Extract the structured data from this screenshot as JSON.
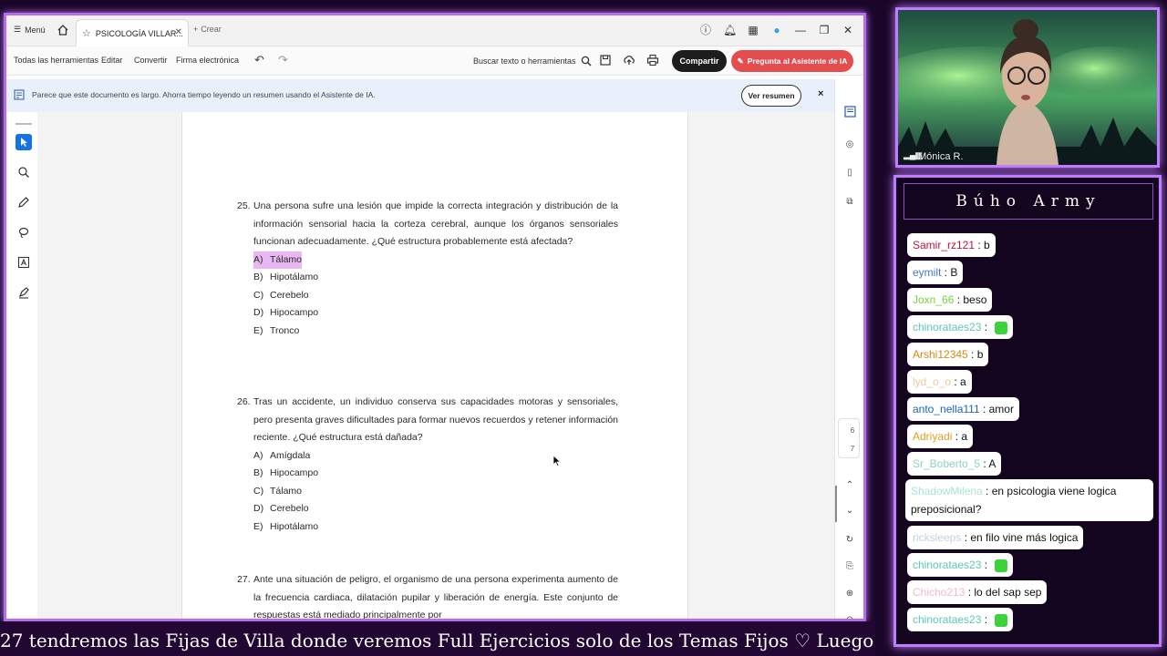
{
  "browser": {
    "menu_label": "Menú",
    "tab_title": "PSICOLOGÍA VILLAR...",
    "new_tab_label": "Crear"
  },
  "toolbar": {
    "all_tools": "Todas las herramientas",
    "edit": "Editar",
    "convert": "Convertir",
    "esign": "Firma electrónica",
    "search_tools": "Buscar texto o herramientas",
    "share": "Compartir",
    "ai_assistant": "Pregunta al Asistente de IA"
  },
  "notice": {
    "text": "Parece que este documento es largo. Ahorra tiempo leyendo un resumen usando el Asistente de IA.",
    "button": "Ver resumen",
    "close": "×"
  },
  "questions": [
    {
      "number": "25.",
      "text": "Una persona sufre una lesión que impide la correcta integración y distribución de la información sensorial hacia la corteza cerebral, aunque los órganos sensoriales funcionan adecuadamente. ¿Qué estructura probablemente está afectada?",
      "options": [
        {
          "letter": "A)",
          "text": "Tálamo"
        },
        {
          "letter": "B)",
          "text": "Hipotálamo"
        },
        {
          "letter": "C)",
          "text": "Cerebelo"
        },
        {
          "letter": "D)",
          "text": "Hipocampo"
        },
        {
          "letter": "E)",
          "text": "Tronco"
        }
      ]
    },
    {
      "number": "26.",
      "text": "Tras un accidente, un individuo conserva sus capacidades motoras y sensoriales, pero presenta graves dificultades para formar nuevos recuerdos y retener información reciente. ¿Qué estructura está dañada?",
      "options": [
        {
          "letter": "A)",
          "text": "Amígdala"
        },
        {
          "letter": "B)",
          "text": "Hipocampo"
        },
        {
          "letter": "C)",
          "text": "Tálamo"
        },
        {
          "letter": "D)",
          "text": "Cerebelo"
        },
        {
          "letter": "E)",
          "text": "Hipotálamo"
        }
      ]
    },
    {
      "number": "27.",
      "text": "Ante una situación de peligro, el organismo de una persona experimenta aumento de la frecuencia cardiaca, dilatación pupilar y liberación de energía. Este conjunto de respuestas está mediado principalmente por"
    }
  ],
  "page_indicator": {
    "current": "6",
    "next": "7"
  },
  "webcam": {
    "name": "Mónica R."
  },
  "chat": {
    "title": "Búho Army",
    "messages": [
      {
        "user": "Samir_rz121",
        "text": ": b",
        "color": "#c0143c"
      },
      {
        "user": "eymilt",
        "text": ": B",
        "color": "#4a78c8"
      },
      {
        "user": "Joxn_66",
        "text": ": beso",
        "color": "#7ad03a"
      },
      {
        "user": "chinorataes23",
        "text": ":",
        "color": "#5fc7b4",
        "emote": true
      },
      {
        "user": "Arshi12345",
        "text": ": b",
        "color": "#d88a12"
      },
      {
        "user": "lyd_o_o",
        "text": ": a",
        "color": "#f0c89c"
      },
      {
        "user": "anto_nella111",
        "text": ": amor",
        "color": "#1a63b8"
      },
      {
        "user": "Adriyadi",
        "text": ": a",
        "color": "#e0a020"
      },
      {
        "user": "Sr_Boberto_5",
        "text": ": A",
        "color": "#8fd1c0"
      },
      {
        "user": "ShadowMilena",
        "text": ": en psicologia viene logica preposicional?",
        "color": "#a9e4d6"
      },
      {
        "user": "ricksleeps",
        "text": ": en filo vine más logica",
        "color": "#c8cfd8"
      },
      {
        "user": "chinorataes23",
        "text": ":",
        "color": "#5fc7b4",
        "emote": true
      },
      {
        "user": "Chicho213",
        "text": ": lo del sap sep",
        "color": "#f2b8c8"
      },
      {
        "user": "chinorataes23",
        "text": ":",
        "color": "#5fc7b4",
        "emote": true
      }
    ]
  },
  "ticker": "27 tendremos las Fijas de Villa donde veremos Full Ejercicios solo de los Temas Fijos ♡ Luego",
  "colors": {
    "accent_purple": "#c07cff",
    "share_bg": "#1d1d1d",
    "ai_bg": "#e34d4d",
    "highlight": "#e9b8f2"
  }
}
